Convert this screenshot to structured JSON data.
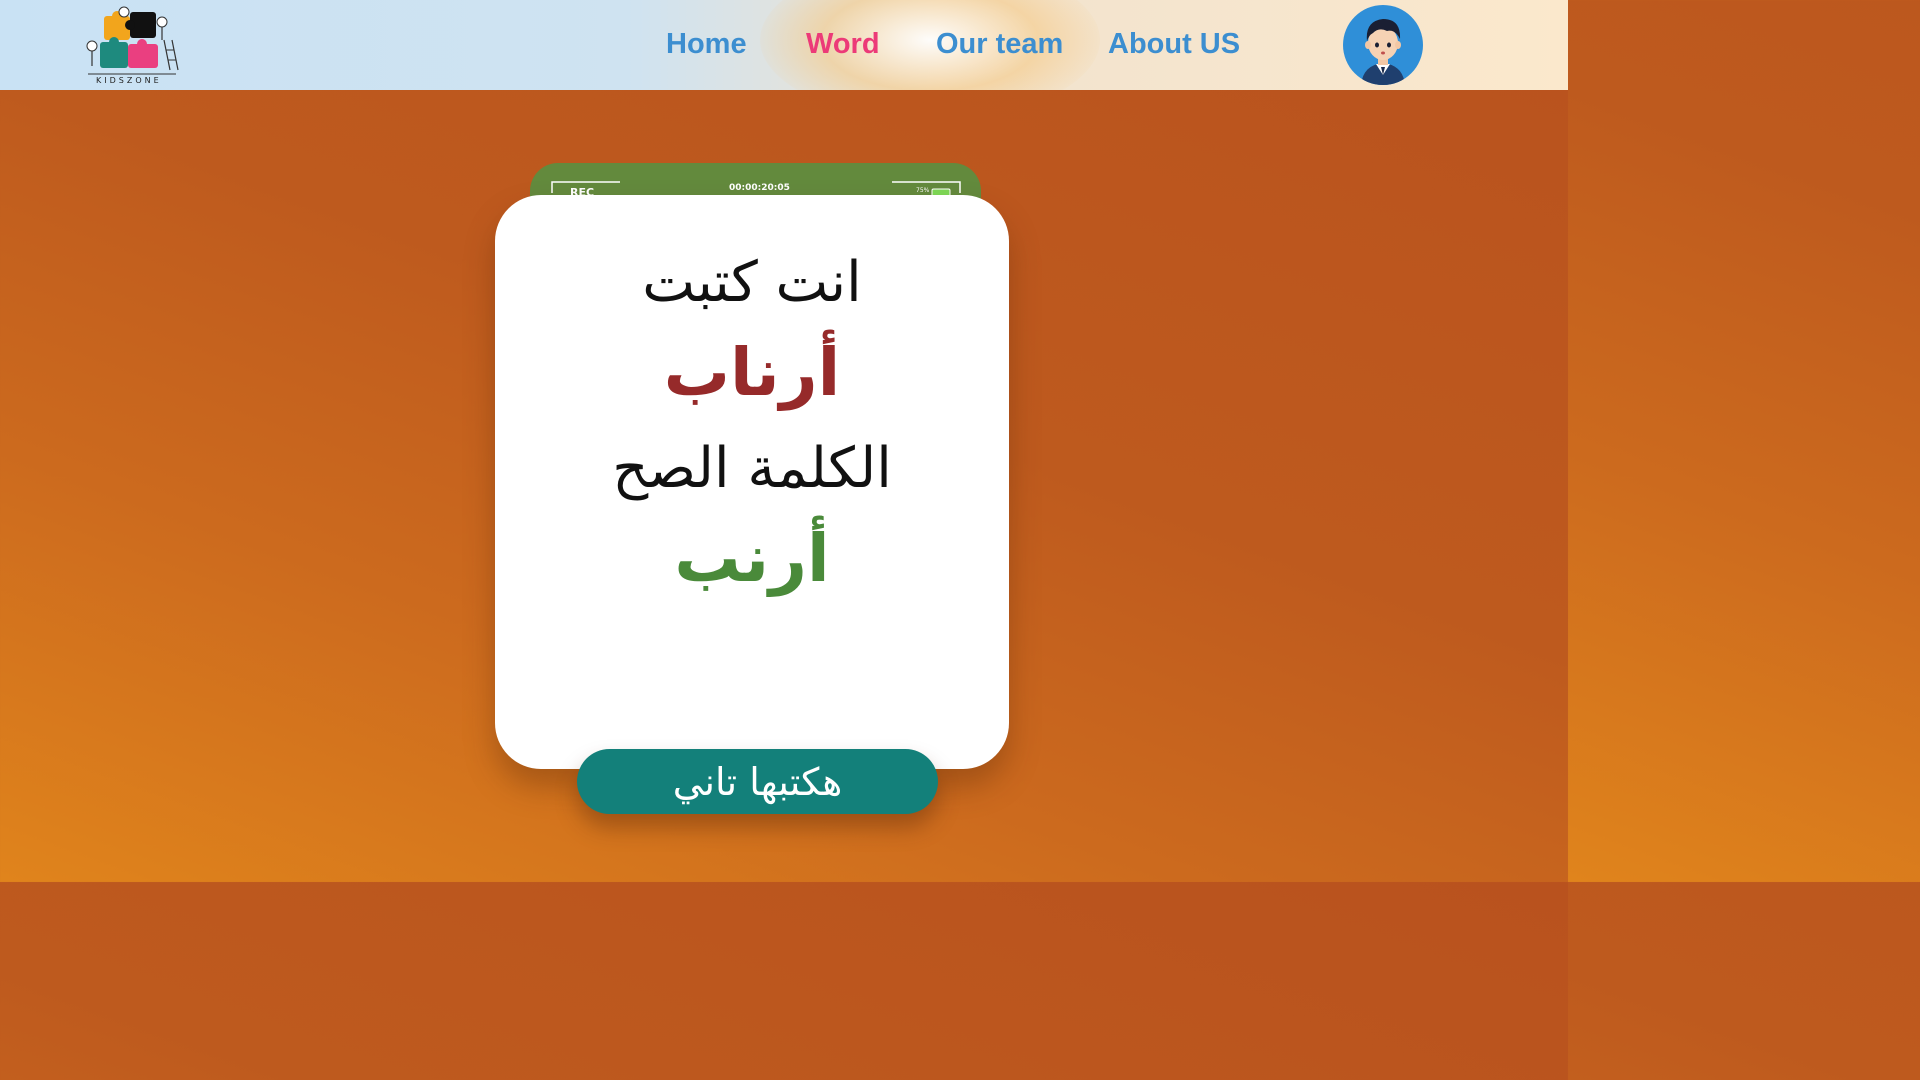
{
  "header": {
    "logo_text": "KIDSZONE",
    "nav": {
      "home": "Home",
      "word": "Word",
      "our_team": "Our team",
      "about_us": "About US"
    },
    "active_nav": "Word"
  },
  "camera": {
    "rec_label": "REC",
    "timer": "00:00:20:05",
    "battery": "75%"
  },
  "card": {
    "line1": "انت كتبت",
    "typed_word": "أرناب",
    "line3": "الكلمة الصح",
    "correct_word": "أرنب"
  },
  "retry_button_label": "هكتبها تاني",
  "colors": {
    "nav_link": "#3c8ed0",
    "nav_active": "#ec3a78",
    "typed_word": "#962a2a",
    "correct_word": "#4a8a3a",
    "button": "#13807a",
    "camera_tab": "#638a3d"
  }
}
